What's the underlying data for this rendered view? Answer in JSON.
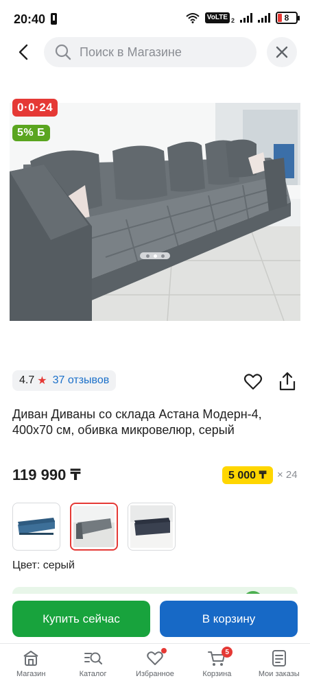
{
  "status_bar": {
    "time": "20:40",
    "network": "VoLTE",
    "sim_index": "2",
    "battery": "8"
  },
  "search": {
    "placeholder": "Поиск в Магазине"
  },
  "gallery": {
    "badges": {
      "installment": "0·0·24",
      "bonus": "5% Б"
    },
    "pages": 3,
    "active_page": 2
  },
  "rating": {
    "value": "4.7",
    "reviews": "37 отзывов"
  },
  "product": {
    "title": "Диван Диваны со склада Астана Модерн-4, 400х70 см, обивка микровелюр, серый",
    "price": "119 990 ₸",
    "installment_amount": "5 000 ₸",
    "installment_months": "× 24"
  },
  "variants": {
    "selected_index": 1,
    "color_label": "Цвет: серый"
  },
  "actions": {
    "buy_now": "Купить сейчас",
    "add_to_cart": "В корзину"
  },
  "bottom_nav": {
    "items": [
      {
        "label": "Магазин",
        "icon": "shop-icon"
      },
      {
        "label": "Каталог",
        "icon": "catalog-search-icon"
      },
      {
        "label": "Избранное",
        "icon": "heart-icon"
      },
      {
        "label": "Корзина",
        "icon": "cart-icon",
        "badge": "5"
      },
      {
        "label": "Мои заказы",
        "icon": "orders-icon"
      }
    ]
  },
  "colors": {
    "accent_red": "#e53935",
    "buy_green": "#18a33d",
    "cart_blue": "#1769c6",
    "installment_yellow": "#ffd600",
    "bonus_green": "#5aa51f",
    "link_blue": "#1a6fc9"
  }
}
